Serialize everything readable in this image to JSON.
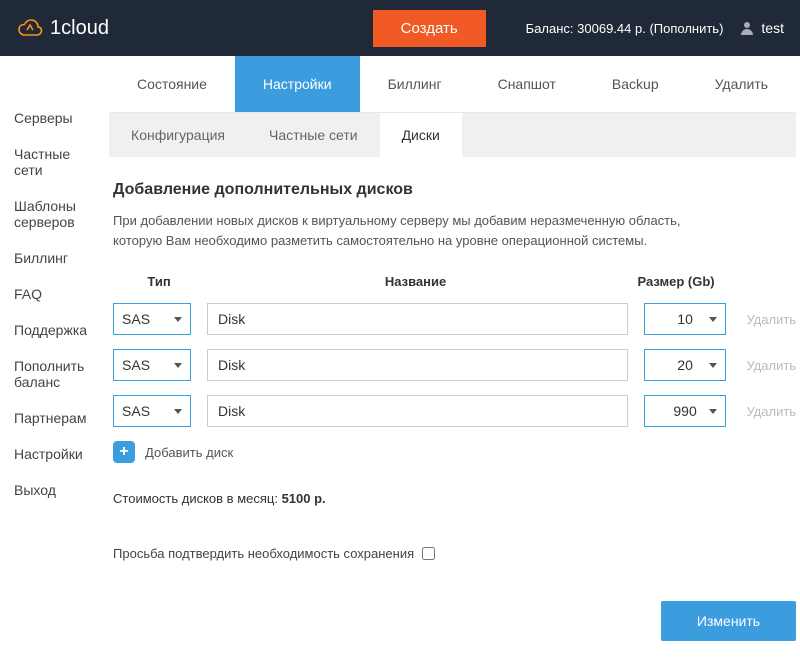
{
  "header": {
    "brand": "1cloud",
    "create_label": "Создать",
    "balance_text": "Баланс: 30069.44 р. (Пополнить)",
    "username": "test"
  },
  "sidebar": {
    "items": [
      {
        "label": "Серверы"
      },
      {
        "label": "Частные сети"
      },
      {
        "label": "Шаблоны серверов"
      },
      {
        "label": "Биллинг"
      },
      {
        "label": "FAQ"
      },
      {
        "label": "Поддержка"
      },
      {
        "label": "Пополнить баланс"
      },
      {
        "label": "Партнерам"
      },
      {
        "label": "Настройки"
      },
      {
        "label": "Выход"
      }
    ]
  },
  "tabs_primary": [
    {
      "label": "Состояние"
    },
    {
      "label": "Настройки",
      "active": true
    },
    {
      "label": "Биллинг"
    },
    {
      "label": "Снапшот"
    },
    {
      "label": "Backup"
    },
    {
      "label": "Удалить"
    }
  ],
  "tabs_secondary": [
    {
      "label": "Конфигурация"
    },
    {
      "label": "Частные сети"
    },
    {
      "label": "Диски",
      "active": true
    }
  ],
  "section": {
    "title": "Добавление дополнительных дисков",
    "description": "При добавлении новых дисков к виртуальному серверу мы добавим неразмеченную область, которую Вам необходимо разметить самостоятельно на уровне операционной системы."
  },
  "table": {
    "headers": {
      "type": "Тип",
      "name": "Название",
      "size": "Размер (Gb)"
    },
    "rows": [
      {
        "type": "SAS",
        "name": "Disk",
        "size": "10",
        "delete": "Удалить"
      },
      {
        "type": "SAS",
        "name": "Disk",
        "size": "20",
        "delete": "Удалить"
      },
      {
        "type": "SAS",
        "name": "Disk",
        "size": "990",
        "delete": "Удалить"
      }
    ],
    "add_label": "Добавить диск"
  },
  "cost": {
    "prefix": "Стоимость дисков в месяц: ",
    "value": "5100 р."
  },
  "confirm_text": "Просьба подтвердить необходимость сохранения",
  "submit_label": "Изменить"
}
